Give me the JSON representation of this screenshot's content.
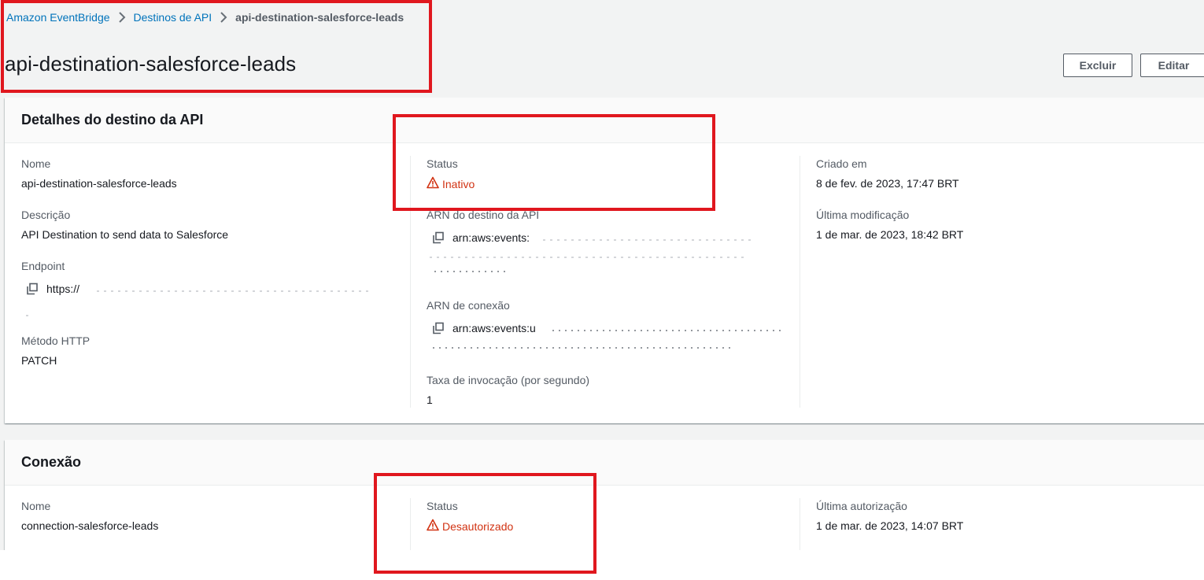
{
  "breadcrumb": {
    "items": [
      "Amazon EventBridge",
      "Destinos de API"
    ],
    "current": "api-destination-salesforce-leads"
  },
  "page": {
    "title": "api-destination-salesforce-leads",
    "delete_label": "Excluir",
    "edit_label": "Editar"
  },
  "details": {
    "title": "Detalhes do destino da API",
    "name_label": "Nome",
    "name_value": "api-destination-salesforce-leads",
    "description_label": "Descrição",
    "description_value": "API Destination to send data to Salesforce",
    "endpoint_label": "Endpoint",
    "endpoint_value": "https://",
    "method_label": "Método HTTP",
    "method_value": "PATCH",
    "status_label": "Status",
    "status_value": "Inativo",
    "arn_label": "ARN do destino da API",
    "arn_value": "arn:aws:events:",
    "connection_arn_label": "ARN de conexão",
    "connection_arn_value": "arn:aws:events:u",
    "rate_label": "Taxa de invocação (por segundo)",
    "rate_value": "1",
    "created_label": "Criado em",
    "created_value": "8 de fev. de 2023, 17:47 BRT",
    "modified_label": "Última modificação",
    "modified_value": "1 de mar. de 2023, 18:42 BRT"
  },
  "connection": {
    "title": "Conexão",
    "name_label": "Nome",
    "name_value": "connection-salesforce-leads",
    "status_label": "Status",
    "status_value": "Desautorizado",
    "auth_label": "Última autorização",
    "auth_value": "1 de mar. de 2023, 14:07 BRT"
  },
  "colors": {
    "link": "#0073bb",
    "error": "#d13212",
    "annotation": "#e0171e"
  }
}
